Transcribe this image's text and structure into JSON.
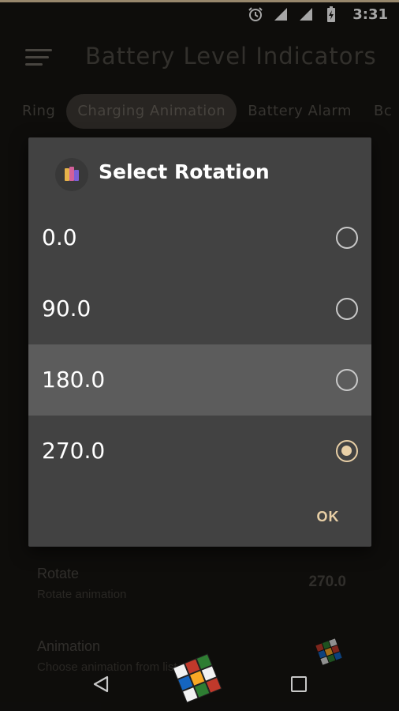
{
  "status_bar": {
    "time": "3:31",
    "icons": [
      "alarm-icon",
      "signal-icon",
      "wifi-icon",
      "battery-charging-icon"
    ]
  },
  "app_bar": {
    "title": "Battery Level Indicators",
    "menu_icon": "hamburger-menu-icon"
  },
  "tabs": [
    {
      "label": "Ring",
      "active": false
    },
    {
      "label": "Charging Animation",
      "active": true
    },
    {
      "label": "Battery Alarm",
      "active": false
    },
    {
      "label": "Bc",
      "active": false
    }
  ],
  "settings": [
    {
      "title": "Rotate",
      "subtitle": "Rotate animation",
      "value": "270.0"
    },
    {
      "title": "Animation",
      "subtitle": "Choose animation from list"
    }
  ],
  "dialog": {
    "title": "Select Rotation",
    "icon": "app-battery-icon",
    "options": [
      {
        "label": "0.0",
        "selected": false,
        "highlighted": false
      },
      {
        "label": "90.0",
        "selected": false,
        "highlighted": false
      },
      {
        "label": "180.0",
        "selected": false,
        "highlighted": true
      },
      {
        "label": "270.0",
        "selected": true,
        "highlighted": false
      }
    ],
    "ok_label": "OK"
  },
  "nav_bar": {
    "icons": [
      "back-icon",
      "home-icon",
      "recents-icon"
    ]
  },
  "colors": {
    "accent": "#e8cfa6",
    "dialog_bg": "#424242",
    "highlight": "#5c5c5c",
    "background": "#161412"
  }
}
